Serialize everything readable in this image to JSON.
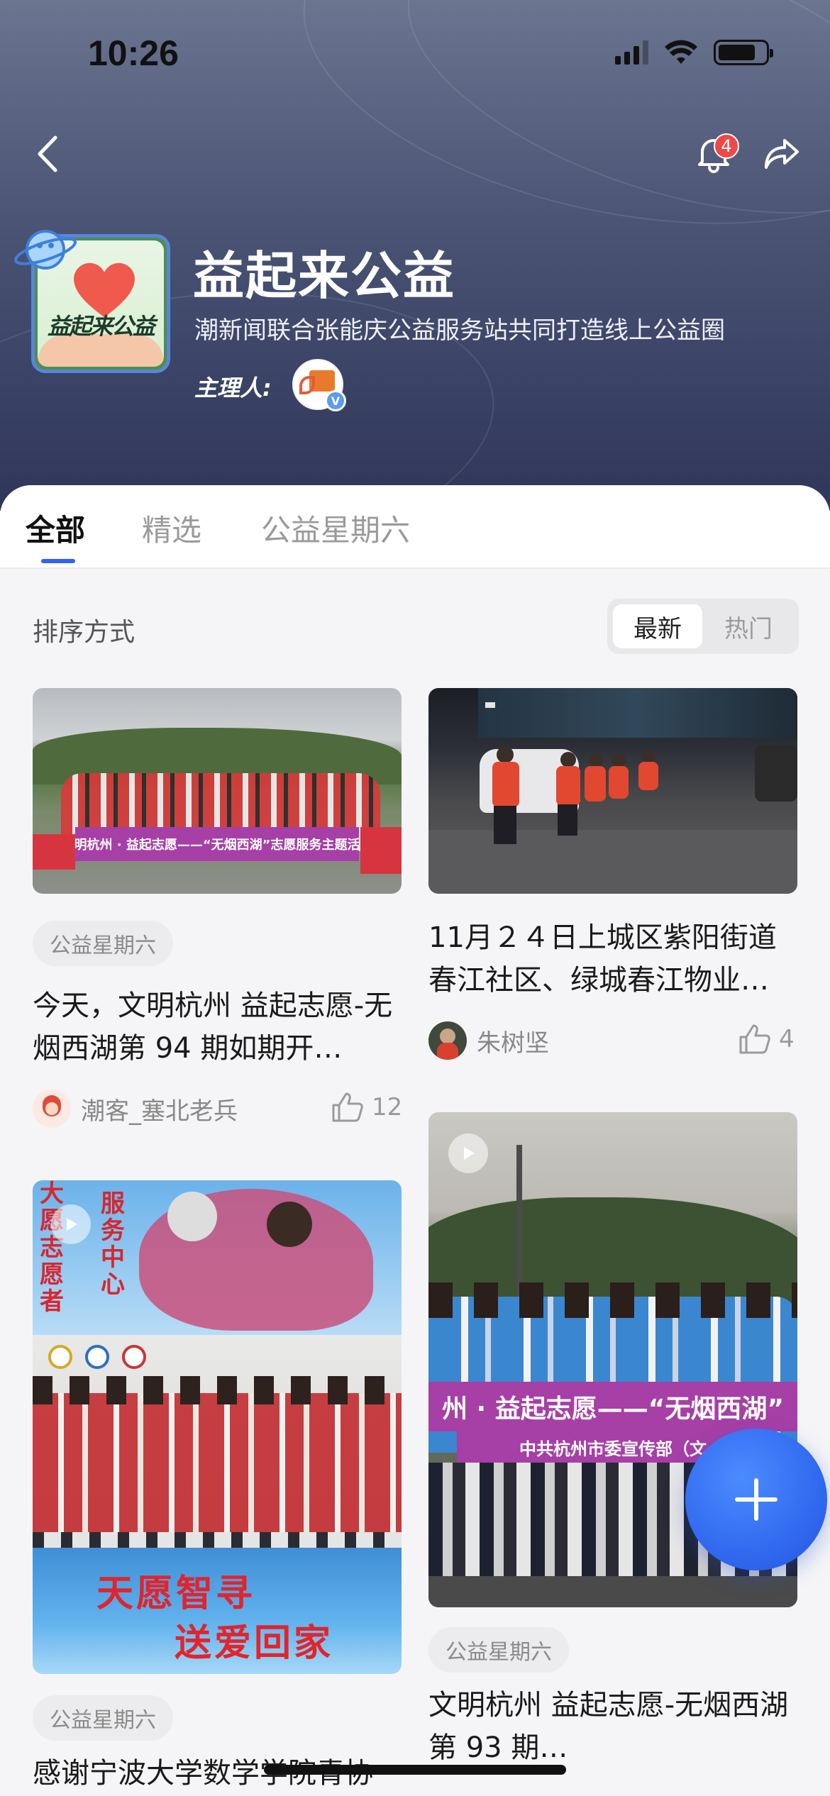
{
  "status_bar": {
    "time": "10:26"
  },
  "header": {
    "notification_count": "4",
    "circle_name": "益起来公益",
    "description": "潮新闻联合张能庆公益服务站共同打造线上公益圈",
    "host_label": "主理人:",
    "logo_text": "益起来公益"
  },
  "tabs": [
    {
      "label": "全部",
      "active": true
    },
    {
      "label": "精选",
      "active": false
    },
    {
      "label": "公益星期六",
      "active": false
    }
  ],
  "sort": {
    "label": "排序方式",
    "options": [
      "最新",
      "热门"
    ],
    "selected": "最新"
  },
  "left_column": [
    {
      "tag": "公益星期六",
      "title": "今天，文明杭州 益起志愿-无烟西湖第 94 期如期开…",
      "author": "潮客_塞北老兵",
      "likes": "12",
      "banner_text": "文明杭州 · 益起志愿——“无烟西湖”志愿服务主题活动"
    },
    {
      "tag": "公益星期六",
      "title": "感谢宁波大学数学学院青协",
      "poster_top_text_a": "大愿志愿者",
      "poster_top_text_b": "服务中心",
      "poster_bottom_line1": "天愿智寻",
      "poster_bottom_line2": "送爱回家",
      "has_video": true
    }
  ],
  "right_column": [
    {
      "title": "11月２４日上城区紫阳街道春江社区、绿城春江物业…",
      "author": "朱树坚",
      "likes": "4"
    },
    {
      "tag": "公益星期六",
      "title": "文明杭州 益起志愿-无烟西湖第 93 期…",
      "banner_text": "州 · 益起志愿——“无烟西湖”",
      "banner_sub": "中共杭州市委宣传部（文",
      "has_video": true
    }
  ]
}
